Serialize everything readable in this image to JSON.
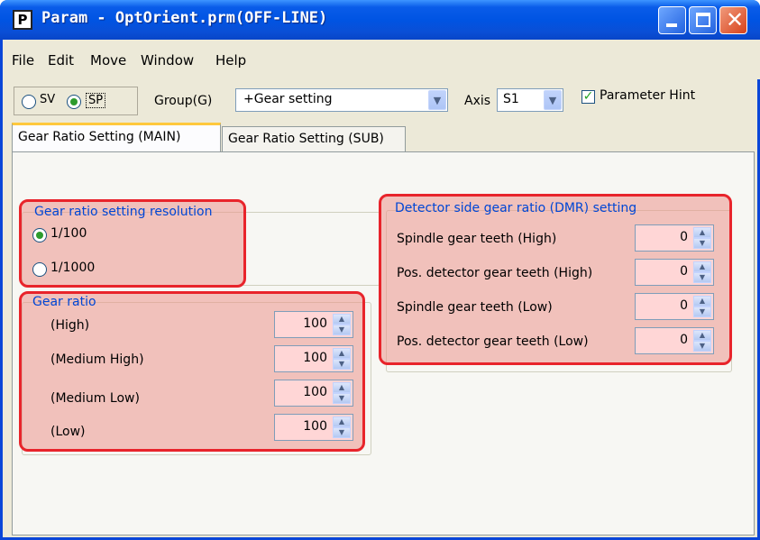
{
  "window": {
    "title": "Param - OptOrient.prm(OFF-LINE)",
    "icon_letter": "P"
  },
  "menu": [
    "File",
    "Edit",
    "Move",
    "Window",
    "Help"
  ],
  "toolbar": {
    "sv_label": "SV",
    "sp_label": "SP",
    "selected_mode": "SP",
    "group_label": "Group(G)",
    "group_value": "+Gear setting",
    "axis_label": "Axis",
    "axis_value": "S1",
    "hint_label": "Parameter Hint",
    "hint_checked": true
  },
  "tabs": [
    {
      "label": "Gear Ratio Setting (MAIN)",
      "active": true
    },
    {
      "label": "Gear Ratio Setting (SUB)",
      "active": false
    }
  ],
  "resolution": {
    "title": "Gear ratio setting resolution",
    "options": [
      "1/100",
      "1/1000"
    ],
    "selected": "1/100"
  },
  "gear_ratio": {
    "title": "Gear ratio",
    "rows": [
      {
        "label": "(High)",
        "value": "100"
      },
      {
        "label": "(Medium High)",
        "value": "100"
      },
      {
        "label": "(Medium Low)",
        "value": "100"
      },
      {
        "label": "(Low)",
        "value": "100"
      }
    ]
  },
  "dmr": {
    "title": "Detector side gear ratio (DMR) setting",
    "rows": [
      {
        "label": "Spindle gear teeth (High)",
        "value": "0"
      },
      {
        "label": "Pos. detector gear teeth (High)",
        "value": "0"
      },
      {
        "label": "Spindle gear teeth (Low)",
        "value": "0"
      },
      {
        "label": "Pos. detector gear teeth (Low)",
        "value": "0"
      }
    ]
  },
  "colors": {
    "title_bar": "#0054e3",
    "highlight": "#e8242b",
    "group_title": "#0046d5",
    "active_tab_accent": "#ffc83c"
  }
}
